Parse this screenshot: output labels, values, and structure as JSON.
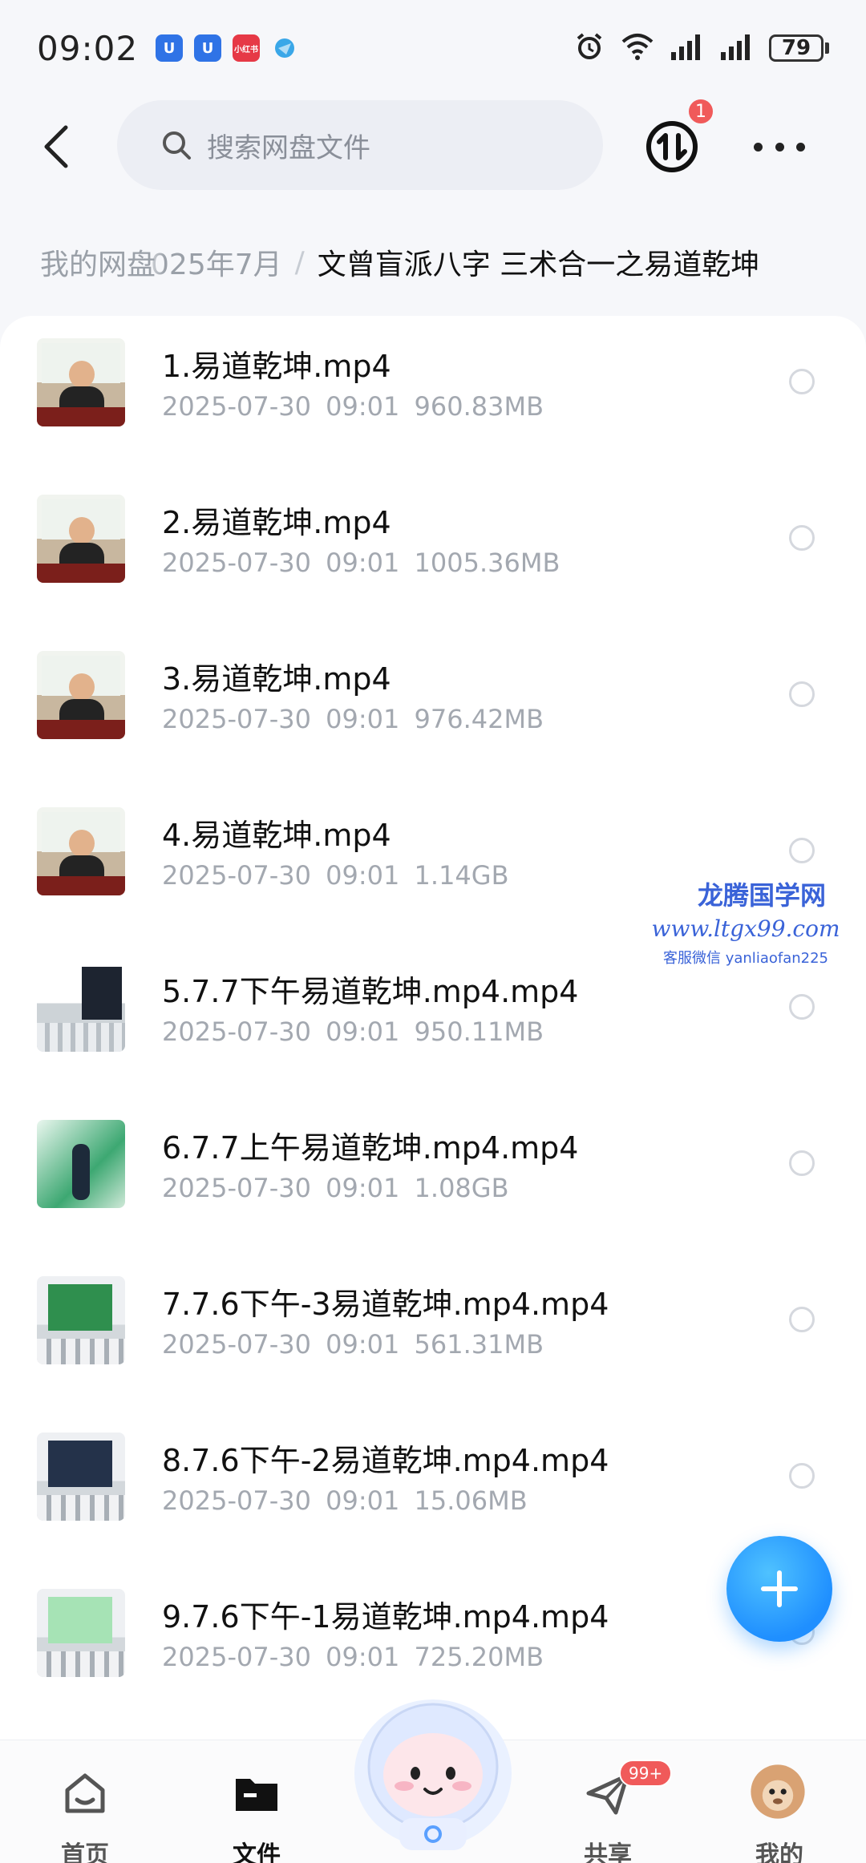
{
  "status_bar": {
    "time": "09:02",
    "notif_app_label": "小红书",
    "battery": "79"
  },
  "header": {
    "search_placeholder": "搜索网盘文件",
    "transfer_badge": "1"
  },
  "breadcrumb": {
    "root": "我的网盘",
    "mid": "025年7月",
    "separator": "/",
    "current": "文曾盲派八字  三术合一之易道乾坤"
  },
  "files": [
    {
      "name": "1.易道乾坤.mp4",
      "date": "2025-07-30",
      "time": "09:01",
      "size": "960.83MB",
      "thumb": "class"
    },
    {
      "name": "2.易道乾坤.mp4",
      "date": "2025-07-30",
      "time": "09:01",
      "size": "1005.36MB",
      "thumb": "class"
    },
    {
      "name": "3.易道乾坤.mp4",
      "date": "2025-07-30",
      "time": "09:01",
      "size": "976.42MB",
      "thumb": "class"
    },
    {
      "name": "4.易道乾坤.mp4",
      "date": "2025-07-30",
      "time": "09:01",
      "size": "1.14GB",
      "thumb": "class"
    },
    {
      "name": "5.7.7下午易道乾坤.mp4.mp4",
      "date": "2025-07-30",
      "time": "09:01",
      "size": "950.11MB",
      "thumb": "hall"
    },
    {
      "name": "6.7.7上午易道乾坤.mp4.mp4",
      "date": "2025-07-30",
      "time": "09:01",
      "size": "1.08GB",
      "thumb": "green"
    },
    {
      "name": "7.7.6下午-3易道乾坤.mp4.mp4",
      "date": "2025-07-30",
      "time": "09:01",
      "size": "561.31MB",
      "thumb": "screen"
    },
    {
      "name": "8.7.6下午-2易道乾坤.mp4.mp4",
      "date": "2025-07-30",
      "time": "09:01",
      "size": "15.06MB",
      "thumb": "screen2"
    },
    {
      "name": "9.7.6下午-1易道乾坤.mp4.mp4",
      "date": "2025-07-30",
      "time": "09:01",
      "size": "725.20MB",
      "thumb": "bright"
    }
  ],
  "watermark": {
    "title": "龙腾国学网",
    "url": "www.ltgx99.com",
    "contact": "客服微信 yanliaofan225"
  },
  "bottom_nav": {
    "home": "首页",
    "files": "文件",
    "share": "共享",
    "share_badge": "99+",
    "mine": "我的"
  },
  "colors": {
    "accent": "#1f8fff",
    "badge": "#f05a5a",
    "watermark": "#3a63d8"
  }
}
